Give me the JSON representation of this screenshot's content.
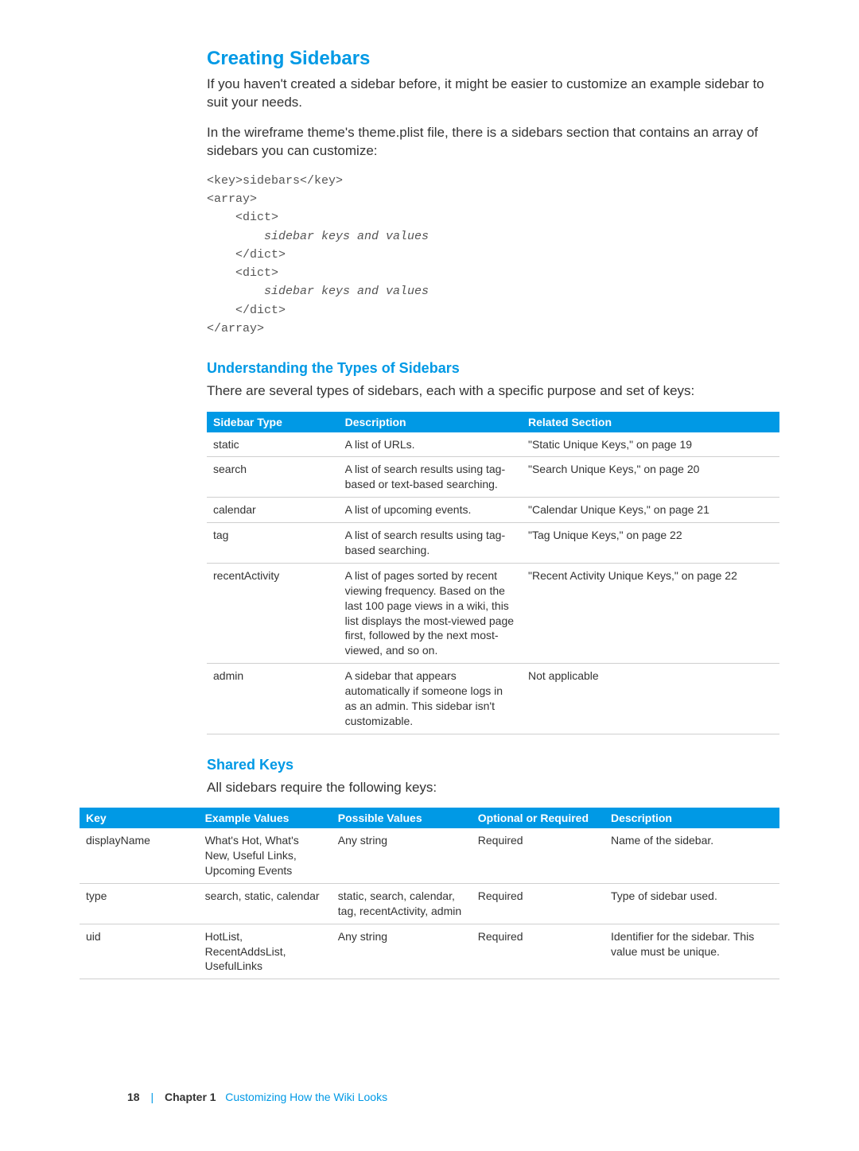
{
  "section": {
    "title": "Creating Sidebars",
    "para1": "If you haven't created a sidebar before, it might be easier to customize an example sidebar to suit your needs.",
    "para2": "In the wireframe theme's theme.plist file, there is a sidebars section that contains an array of sidebars you can customize:",
    "code_l1": "<key>sidebars</key>",
    "code_l2": "<array>",
    "code_l3": "    <dict>",
    "code_l4": "        sidebar keys and values",
    "code_l5": "    </dict>",
    "code_l6": "    <dict>",
    "code_l7": "        sidebar keys and values",
    "code_l8": "    </dict>",
    "code_l9": "</array>"
  },
  "subsection1": {
    "title": "Understanding the Types of Sidebars",
    "para": "There are several types of sidebars, each with a specific purpose and set of keys:"
  },
  "table1": {
    "headers": {
      "c0": "Sidebar Type",
      "c1": "Description",
      "c2": "Related Section"
    },
    "rows": [
      {
        "c0": "static",
        "c1": "A list of URLs.",
        "c2": "\"Static Unique Keys,\" on page 19"
      },
      {
        "c0": "search",
        "c1": "A list of search results using tag-based or text-based searching.",
        "c2": "\"Search Unique Keys,\" on page 20"
      },
      {
        "c0": "calendar",
        "c1": "A list of upcoming events.",
        "c2": "\"Calendar Unique Keys,\" on page 21"
      },
      {
        "c0": "tag",
        "c1": "A list of search results using tag-based searching.",
        "c2": "\"Tag Unique Keys,\" on page 22"
      },
      {
        "c0": "recentActivity",
        "c1": "A list of pages sorted by recent viewing frequency. Based on the last 100 page views in a wiki, this list displays the most-viewed page first, followed by the next most-viewed, and so on.",
        "c2": "\"Recent Activity Unique Keys,\" on page 22"
      },
      {
        "c0": "admin",
        "c1": "A sidebar that appears automatically if someone logs in as an admin. This sidebar isn't customizable.",
        "c2": "Not applicable"
      }
    ]
  },
  "subsection2": {
    "title": "Shared Keys",
    "para": "All sidebars require the following keys:"
  },
  "table2": {
    "headers": {
      "c0": "Key",
      "c1": "Example Values",
      "c2": "Possible Values",
      "c3": "Optional or Required",
      "c4": "Description"
    },
    "rows": [
      {
        "c0": "displayName",
        "c1": "What's Hot, What's New, Useful Links, Upcoming Events",
        "c2": "Any string",
        "c3": "Required",
        "c4": "Name of the sidebar."
      },
      {
        "c0": "type",
        "c1": "search, static, calendar",
        "c2": "static, search, calendar, tag, recentActivity, admin",
        "c3": "Required",
        "c4": "Type of sidebar used."
      },
      {
        "c0": "uid",
        "c1": "HotList, RecentAddsList, UsefulLinks",
        "c2": "Any string",
        "c3": "Required",
        "c4": "Identifier for the sidebar. This value must be unique."
      }
    ]
  },
  "footer": {
    "page": "18",
    "chapter_label": "Chapter 1",
    "chapter_title": "Customizing How the Wiki Looks"
  }
}
